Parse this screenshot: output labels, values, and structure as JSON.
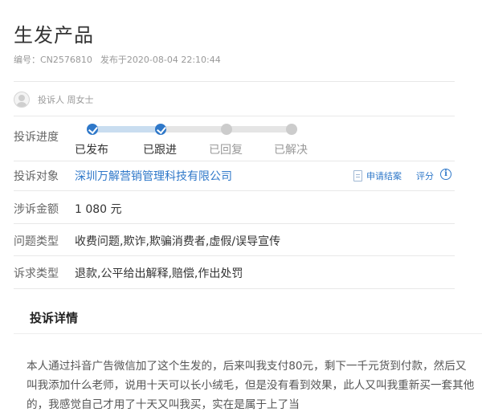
{
  "header": {
    "title": "生发产品",
    "id_label": "编号：CN2576810",
    "published": "发布于2020-08-04 22:10:44"
  },
  "complainant": {
    "label": "投诉人 周女士"
  },
  "progress": {
    "label": "投诉进度",
    "steps": [
      {
        "label": "已发布",
        "done": true
      },
      {
        "label": "已跟进",
        "done": true
      },
      {
        "label": "已回复",
        "done": false
      },
      {
        "label": "已解决",
        "done": false
      }
    ]
  },
  "target": {
    "label": "投诉对象",
    "value": "深圳万解营销管理科技有限公司",
    "apply_close": "申请结案",
    "rate": "评分",
    "info": "i"
  },
  "amount": {
    "label": "涉诉金额",
    "value": "1 080 元"
  },
  "problem": {
    "label": "问题类型",
    "value": "收费问题,欺诈,欺骗消费者,虚假/误导宣传"
  },
  "demand": {
    "label": "诉求类型",
    "value": "退款,公平给出解释,赔偿,作出处罚"
  },
  "details": {
    "title": "投诉详情",
    "text": "本人通过抖音广告微信加了这个生发的，后来叫我支付80元，剩下一千元货到付款，然后又叫我添加什么老师，说用十天可以长小绒毛，但是没有看到效果，此人又叫我重新买一套其他的，我感觉自己才用了十天又叫我买，实在是属于上了当"
  },
  "colors": {
    "accent": "#2f78c9",
    "progress_done": "#c9ddf0",
    "progress_todo": "#e5e5e5"
  }
}
